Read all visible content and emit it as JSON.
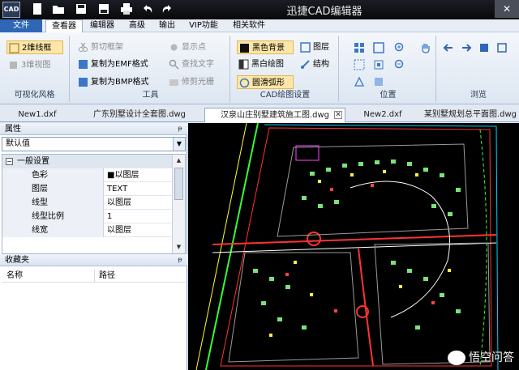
{
  "titlebar": {
    "logo_text": "CAD",
    "title": "迅捷CAD编辑器",
    "close_label": "✕"
  },
  "menubar": {
    "items": [
      "文件",
      "查看器",
      "编辑器",
      "高级",
      "输出",
      "VIP功能",
      "相关软件"
    ]
  },
  "ribbon": {
    "groups": [
      {
        "label": "可视化风格",
        "buttons": [
          "2维线框",
          "3维视图"
        ]
      },
      {
        "label": "工具",
        "buttons": [
          "剪切框架",
          "复制为EMF格式",
          "复制为BMP格式",
          "显示点",
          "查找文字",
          "修剪光栅"
        ]
      },
      {
        "label": "CAD绘图设置",
        "buttons": [
          "黑色背景",
          "黑白绘图",
          "圆滑弧形",
          "图层",
          "结构"
        ]
      },
      {
        "label": "位置",
        "buttons": []
      },
      {
        "label": "浏览",
        "buttons": []
      }
    ]
  },
  "tabs": {
    "items": [
      "New1.dxf",
      "广东别墅设计全套图.dwg",
      "汉泉山庄别墅建筑施工图.dwg",
      "New2.dxf",
      "某别墅规划总平面图.dwg"
    ],
    "active_index": 2,
    "close_label": "✕"
  },
  "properties": {
    "header": "属性",
    "pin_label": "ᵽ",
    "selector_value": "默认值",
    "section": "一般设置",
    "section_toggle": "−",
    "rows": [
      {
        "name": "色彩",
        "value": "■以图层"
      },
      {
        "name": "图层",
        "value": "TEXT"
      },
      {
        "name": "线型",
        "value": "以图层"
      },
      {
        "name": "线型比例",
        "value": "1"
      },
      {
        "name": "线宽",
        "value": "以图层"
      }
    ]
  },
  "favorites": {
    "header": "收藏夹",
    "pin_label": "ᵽ",
    "columns": [
      "名称",
      "路径"
    ]
  },
  "watermark": {
    "text": "悟空问答"
  },
  "colors": {
    "accent": "#2f67b6",
    "canvas_bg": "#000000",
    "ribbon_selected": "#fde6a8"
  }
}
